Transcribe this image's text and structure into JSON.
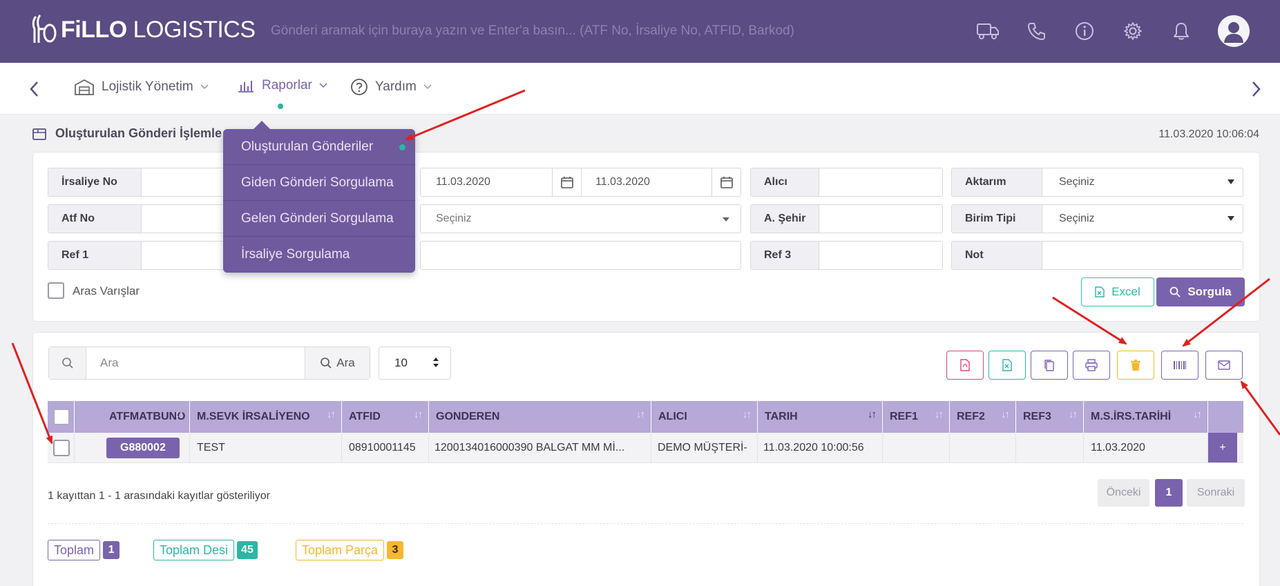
{
  "header": {
    "logo_bold": "FiLLO",
    "logo_light": " LOGISTICS",
    "search_placeholder": "Gönderi aramak için buraya yazın ve Enter'a basın... (ATF No, İrsaliye No, ATFID, Barkod)",
    "icons": [
      "truck-icon",
      "phone-icon",
      "info-icon",
      "gear-icon",
      "bell-icon",
      "user-avatar"
    ]
  },
  "nav": {
    "items": [
      {
        "label": "Lojistik Yönetim",
        "icon": "warehouse-icon"
      },
      {
        "label": "Raporlar",
        "icon": "bar-chart-icon"
      },
      {
        "label": "Yardım",
        "icon": "help-icon"
      }
    ]
  },
  "dropdown": {
    "items": [
      {
        "label": "Oluşturulan Gönderiler"
      },
      {
        "label": "Giden Gönderi Sorgulama"
      },
      {
        "label": "Gelen Gönderi Sorgulama"
      },
      {
        "label": "İrsaliye Sorgulama"
      }
    ]
  },
  "page": {
    "title": "Oluşturulan Gönderi İşlemle",
    "datetime": "11.03.2020 10:06:04"
  },
  "filters": {
    "irsaliye_no": {
      "label": "İrsaliye No",
      "value": ""
    },
    "atf_no": {
      "label": "Atf No",
      "value": ""
    },
    "ref1": {
      "label": "Ref 1",
      "value": ""
    },
    "date_from": "11.03.2020",
    "date_to": "11.03.2020",
    "mid_select": "Seçiniz",
    "alici": {
      "label": "Alıcı",
      "value": ""
    },
    "a_sehir": {
      "label": "A. Şehir",
      "value": ""
    },
    "ref3": {
      "label": "Ref 3",
      "value": ""
    },
    "aktarim": {
      "label": "Aktarım",
      "value": "Seçiniz"
    },
    "birim_tipi": {
      "label": "Birim Tipi",
      "value": "Seçiniz"
    },
    "not": {
      "label": "Not",
      "value": ""
    },
    "aras_varislar": "Aras Varışlar",
    "excel_label": "Excel",
    "sorgula_label": "Sorgula"
  },
  "table_controls": {
    "search_placeholder": "Ara",
    "search_button": "Ara",
    "page_size": "10"
  },
  "table": {
    "columns": [
      "ATFMATBUNO",
      "M.SEVK İRSALİYENO",
      "ATFID",
      "GONDEREN",
      "ALICI",
      "TARIH",
      "REF1",
      "REF2",
      "REF3",
      "M.S.İRS.TARİHİ"
    ],
    "rows": [
      {
        "atfmatbuno": "G880002",
        "m_sevk_irsaliyeno": "TEST",
        "atfid": "08910001145",
        "gonderen": "1200134016000390 BALGAT MM Mİ...",
        "alici": "DEMO MÜŞTERİ-",
        "tarih": "11.03.2020 10:00:56",
        "ref1": "",
        "ref2": "",
        "ref3": "",
        "ms_irs_tarihi": "11.03.2020",
        "action": "+"
      }
    ]
  },
  "footer": {
    "info": "1 kayıttan 1 - 1 arasındaki kayıtlar gösteriliyor",
    "prev": "Önceki",
    "page": "1",
    "next": "Sonraki"
  },
  "totals": {
    "toplam_label": "Toplam",
    "toplam_value": "1",
    "desi_label": "Toplam Desi",
    "desi_value": "45",
    "parca_label": "Toplam Parça",
    "parca_value": "3"
  },
  "colors": {
    "primary": "#7a63ad",
    "header": "#5b4c83",
    "teal": "#2ab7a4",
    "pink": "#e0457b",
    "amber": "#f5b82e",
    "annotation_red": "#e02020"
  }
}
